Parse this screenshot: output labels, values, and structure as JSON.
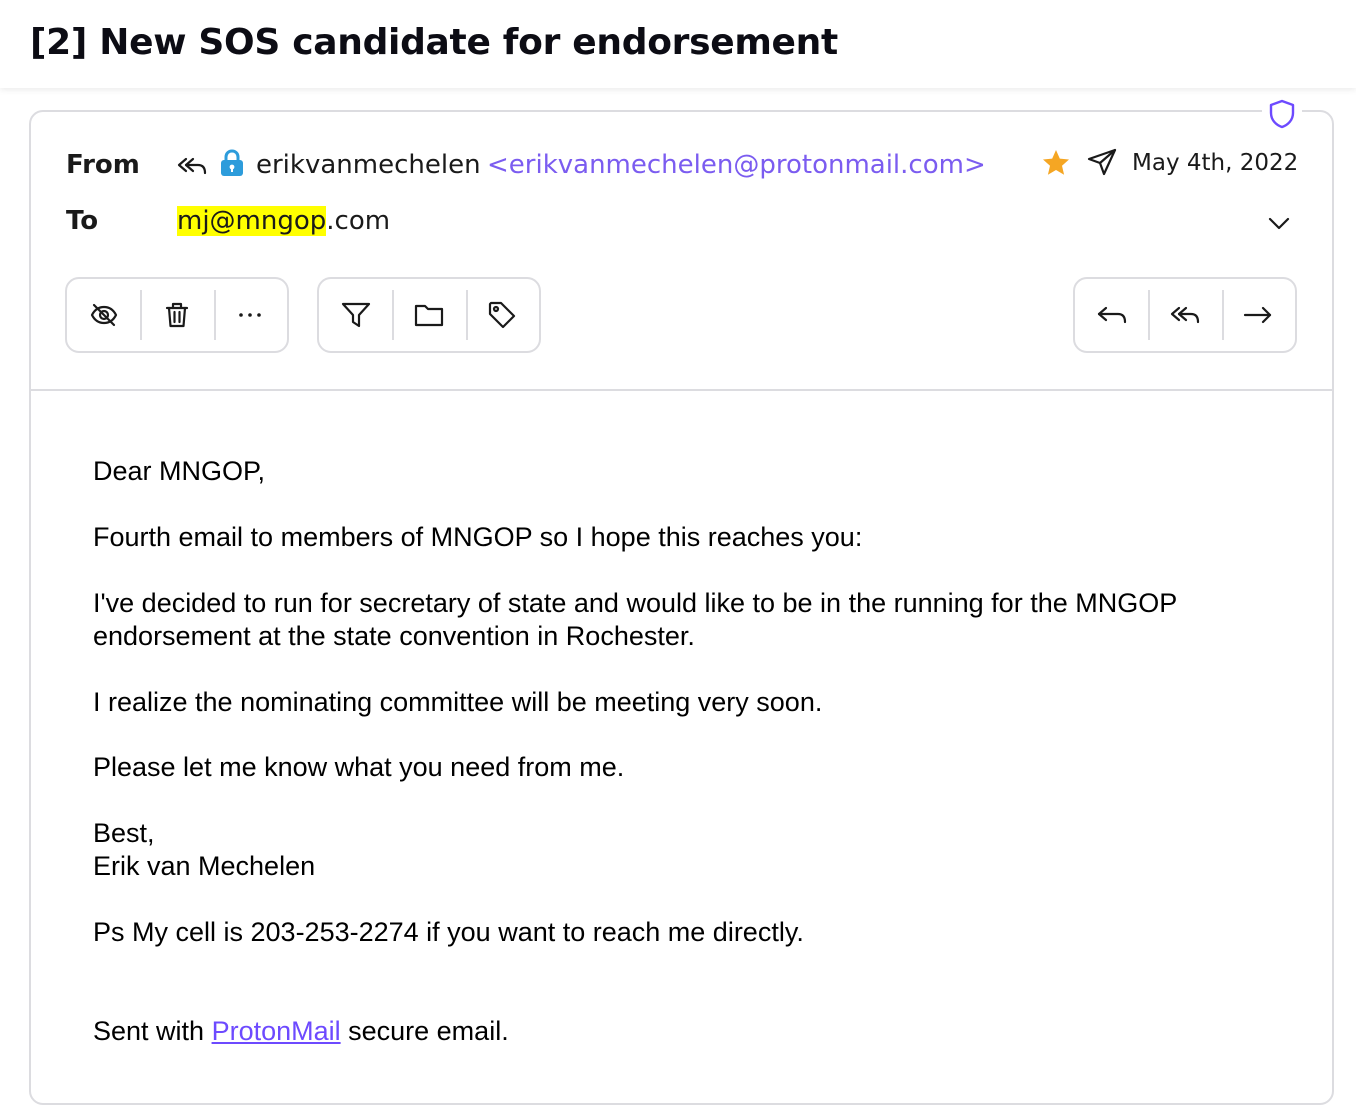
{
  "subject": "[2] New SOS candidate for endorsement",
  "header": {
    "from_label": "From",
    "to_label": "To",
    "sender_name": "erikvanmechelen",
    "sender_address": "<erikvanmechelen@protonmail.com>",
    "recipient_highlighted": "mj@mngop",
    "recipient_rest": ".com",
    "date": "May 4th, 2022",
    "starred": true
  },
  "icons": {
    "shield": "shield-icon",
    "replied": "reply-all-icon",
    "lock": "lock-icon",
    "star": "star-icon",
    "sent": "paper-plane-icon",
    "expand": "chevron-down-icon"
  },
  "toolbar": {
    "group1": [
      "eye-slash-icon",
      "trash-icon",
      "more-icon"
    ],
    "group2": [
      "filter-icon",
      "folder-icon",
      "tag-icon"
    ],
    "group3": [
      "reply-icon",
      "reply-all-icon",
      "forward-icon"
    ]
  },
  "body": {
    "greeting": "Dear MNGOP,",
    "p1": "Fourth email to members of MNGOP so I hope this reaches you:",
    "p2_line1": "I've decided to run for secretary of state and would like to be in the running for the MNGOP",
    "p2_line2": "endorsement at the state convention in Rochester.",
    "p3": "I realize the nominating committee will be meeting very soon.",
    "p4": "Please let me know what you need from me.",
    "signoff": "Best,",
    "signature": "Erik van Mechelen",
    "ps": "Ps My cell is 203-253-2274 if you want to reach me directly.",
    "footer_prefix": "Sent with ",
    "footer_link": "ProtonMail",
    "footer_suffix": " secure email."
  },
  "colors": {
    "accent": "#6d4aff",
    "sender_address": "#7b5cf0",
    "star": "#f5a623",
    "lock": "#2d9cdb",
    "highlight": "#ffff00",
    "border": "#dcdce0"
  }
}
